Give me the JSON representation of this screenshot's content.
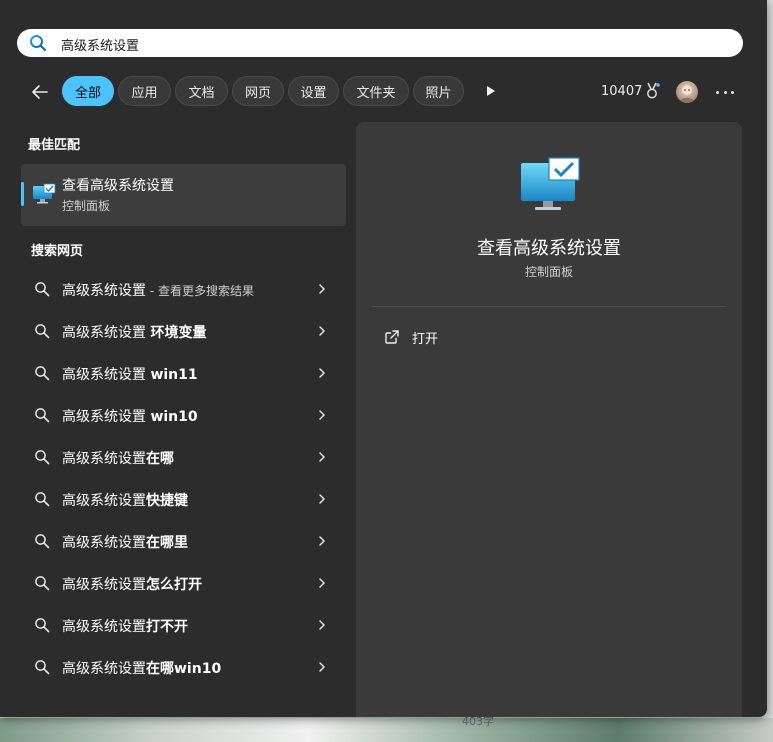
{
  "background": {
    "caption": "403字"
  },
  "search": {
    "icon": "search-icon",
    "query": "高级系统设置"
  },
  "filters": {
    "back_icon": "back-arrow-icon",
    "chips": [
      {
        "label": "全部",
        "active": true
      },
      {
        "label": "应用",
        "active": false
      },
      {
        "label": "文档",
        "active": false
      },
      {
        "label": "网页",
        "active": false
      },
      {
        "label": "设置",
        "active": false
      },
      {
        "label": "文件夹",
        "active": false
      },
      {
        "label": "照片",
        "active": false
      }
    ],
    "more_chips_icon": "play-icon",
    "points": "10407",
    "points_icon": "medal-icon",
    "avatar_icon": "avatar",
    "more_icon": "more-icon"
  },
  "best_match": {
    "heading": "最佳匹配",
    "title": "查看高级系统设置",
    "subtitle": "控制面板",
    "icon": "monitor-check-icon"
  },
  "web": {
    "heading": "搜索网页",
    "items": [
      {
        "prefix": "高级系统设置",
        "suffix": " - 查看更多搜索结果",
        "bold": ""
      },
      {
        "prefix": "高级系统设置 ",
        "suffix": "",
        "bold": "环境变量"
      },
      {
        "prefix": "高级系统设置 ",
        "suffix": "",
        "bold": "win11"
      },
      {
        "prefix": "高级系统设置 ",
        "suffix": "",
        "bold": "win10"
      },
      {
        "prefix": "高级系统设置",
        "suffix": "",
        "bold": "在哪"
      },
      {
        "prefix": "高级系统设置",
        "suffix": "",
        "bold": "快捷键"
      },
      {
        "prefix": "高级系统设置",
        "suffix": "",
        "bold": "在哪里"
      },
      {
        "prefix": "高级系统设置",
        "suffix": "",
        "bold": "怎么打开"
      },
      {
        "prefix": "高级系统设置",
        "suffix": "",
        "bold": "打不开"
      },
      {
        "prefix": "高级系统设置",
        "suffix": "",
        "bold": "在哪win10"
      }
    ]
  },
  "preview": {
    "title": "查看高级系统设置",
    "subtitle": "控制面板",
    "icon": "monitor-check-icon",
    "action_label": "打开",
    "action_icon": "open-external-icon"
  },
  "colors": {
    "accent": "#4cc2ff",
    "panel_bg": "#2c2c2c",
    "preview_bg": "#3a3a3a"
  }
}
